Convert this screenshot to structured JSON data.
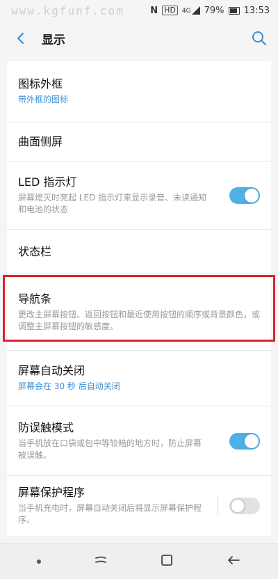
{
  "status_bar": {
    "watermark": "www.kgfunf.com",
    "nfc": "N",
    "hd": "HD",
    "signal": "4G",
    "battery": "79%",
    "time": "13:53"
  },
  "header": {
    "title": "显示"
  },
  "items": [
    {
      "title": "图标外框",
      "subtitle": "带外框的图标"
    },
    {
      "title": "曲面侧屏"
    },
    {
      "title": "LED 指示灯",
      "subtitle": "屏幕熄灭时亮起 LED 指示灯来显示录音、未读通知和电池的状态",
      "toggle": true
    },
    {
      "title": "状态栏"
    },
    {
      "title": "导航条",
      "subtitle": "更改主屏幕按钮、返回按钮和最近使用按钮的顺序或背景颜色，或调整主屏幕按钮的敏感度。"
    },
    {
      "title": "屏幕自动关闭",
      "subtitle": "屏幕会在 30 秒 后自动关闭"
    },
    {
      "title": "防误触模式",
      "subtitle": "当手机放在口袋或包中等较暗的地方时，防止屏幕被误触。",
      "toggle": true
    },
    {
      "title": "屏幕保护程序",
      "subtitle": "当手机充电时，屏幕自动关闭后将显示屏幕保护程序。",
      "toggle": false
    }
  ],
  "colors": {
    "accent": "#3b8fd6",
    "toggle_on": "#4db0e6",
    "highlight": "#d9232e"
  }
}
